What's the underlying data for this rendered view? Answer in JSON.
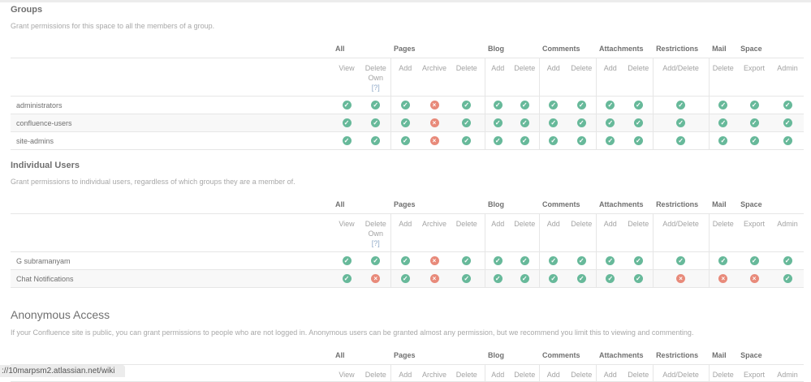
{
  "groups_label_help": "[?]",
  "column_groups": [
    {
      "label": "All",
      "span": 2
    },
    {
      "label": "Pages",
      "span": 3
    },
    {
      "label": "Blog",
      "span": 2
    },
    {
      "label": "Comments",
      "span": 2
    },
    {
      "label": "Attachments",
      "span": 2
    },
    {
      "label": "Restrictions",
      "span": 1
    },
    {
      "label": "Mail",
      "span": 1
    },
    {
      "label": "Space",
      "span": 2
    }
  ],
  "columns": [
    "View",
    "Delete Own",
    "Add",
    "Archive",
    "Delete",
    "Add",
    "Delete",
    "Add",
    "Delete",
    "Add",
    "Delete",
    "Add/Delete",
    "Delete",
    "Export",
    "Admin"
  ],
  "sections": [
    {
      "title": "Groups",
      "description": "Grant permissions for this space to all the members of a group.",
      "rows": [
        {
          "name": "administrators",
          "perms": [
            true,
            true,
            true,
            false,
            true,
            true,
            true,
            true,
            true,
            true,
            true,
            true,
            true,
            true,
            true
          ]
        },
        {
          "name": "confluence-users",
          "perms": [
            true,
            true,
            true,
            false,
            true,
            true,
            true,
            true,
            true,
            true,
            true,
            true,
            true,
            true,
            true
          ]
        },
        {
          "name": "site-admins",
          "perms": [
            true,
            true,
            true,
            false,
            true,
            true,
            true,
            true,
            true,
            true,
            true,
            true,
            true,
            true,
            true
          ]
        }
      ]
    },
    {
      "title": "Individual Users",
      "description": "Grant permissions to individual users, regardless of which groups they are a member of.",
      "rows": [
        {
          "name": "G subramanyam",
          "perms": [
            true,
            true,
            true,
            false,
            true,
            true,
            true,
            true,
            true,
            true,
            true,
            true,
            true,
            true,
            true
          ]
        },
        {
          "name": "Chat Notifications",
          "perms": [
            true,
            false,
            true,
            false,
            true,
            true,
            true,
            true,
            true,
            true,
            true,
            false,
            false,
            false,
            true
          ]
        }
      ]
    },
    {
      "title": "Anonymous Access",
      "description": "If your Confluence site is public, you can grant permissions to people who are not logged in. Anonymous users can be granted almost any permission, but we recommend you limit this to viewing and commenting.",
      "columns": [
        "View",
        "Delete",
        "Add",
        "Archive",
        "Delete",
        "Add",
        "Delete",
        "Add",
        "Delete",
        "Add",
        "Delete",
        "Add/Delete",
        "Delete",
        "Export",
        "Admin"
      ],
      "rows": []
    }
  ],
  "status_bar": "://10marpsm2.atlassian.net/wiki",
  "colors": {
    "allowed": "#67b99a",
    "denied": "#e88a7a"
  }
}
